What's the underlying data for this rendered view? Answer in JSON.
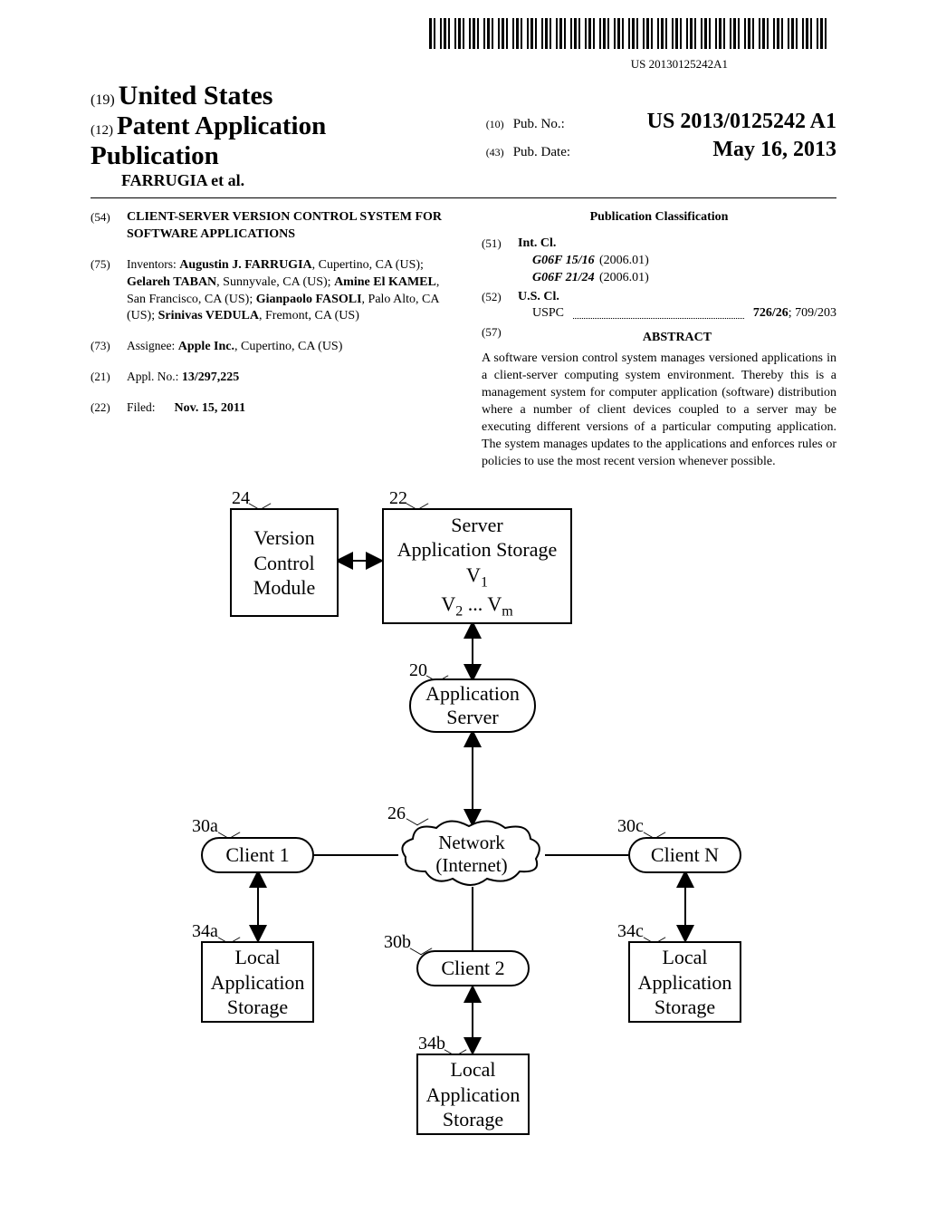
{
  "barcode_text": "US 20130125242A1",
  "header": {
    "code19": "(19)",
    "us": "United States",
    "code12": "(12)",
    "pubtype": "Patent Application Publication",
    "authors": "FARRUGIA et al.",
    "pubno_code": "(10)",
    "pubno_label": "Pub. No.:",
    "pubno": "US 2013/0125242 A1",
    "pubdate_code": "(43)",
    "pubdate_label": "Pub. Date:",
    "pubdate": "May 16, 2013"
  },
  "title_entry": {
    "num": "(54)",
    "text": "CLIENT-SERVER VERSION CONTROL SYSTEM FOR SOFTWARE APPLICATIONS"
  },
  "inventors_entry": {
    "num": "(75)",
    "label": "Inventors:",
    "text": "Augustin J. FARRUGIA, Cupertino, CA (US); Gelareh TABAN, Sunnyvale, CA (US); Amine El KAMEL, San Francisco, CA (US); Gianpaolo FASOLI, Palo Alto, CA (US); Srinivas VEDULA, Fremont, CA (US)"
  },
  "assignee_entry": {
    "num": "(73)",
    "label": "Assignee:",
    "text": "Apple Inc., Cupertino, CA (US)"
  },
  "appl_entry": {
    "num": "(21)",
    "label": "Appl. No.:",
    "text": "13/297,225"
  },
  "filed_entry": {
    "num": "(22)",
    "label": "Filed:",
    "text": "Nov. 15, 2011"
  },
  "classification": {
    "title": "Publication Classification",
    "intcl_num": "(51)",
    "intcl_label": "Int. Cl.",
    "intcl_rows": [
      {
        "code": "G06F 15/16",
        "year": "(2006.01)"
      },
      {
        "code": "G06F 21/24",
        "year": "(2006.01)"
      }
    ],
    "uscl_num": "(52)",
    "uscl_label": "U.S. Cl.",
    "uspc_label": "USPC",
    "uspc_codes": "726/26; 709/203"
  },
  "abstract": {
    "num": "(57)",
    "title": "ABSTRACT",
    "text": "A software version control system manages versioned applications in a client-server computing system environment. Thereby this is a management system for computer application (software) distribution where a number of client devices coupled to a server may be executing different versions of a particular computing application. The system manages updates to the applications and enforces rules or policies to use the most recent version whenever possible."
  },
  "figure": {
    "ref24": "24",
    "ref22": "22",
    "ref20": "20",
    "ref26": "26",
    "ref30a": "30a",
    "ref30b": "30b",
    "ref30c": "30c",
    "ref34a": "34a",
    "ref34b": "34b",
    "ref34c": "34c",
    "vcm1": "Version",
    "vcm2": "Control",
    "vcm3": "Module",
    "sas1": "Server",
    "sas2": "Application Storage",
    "v1": "V",
    "vsub1": "1",
    "v2": "V",
    "vsub2": "2",
    "vellip": " ... V",
    "vsubm": "m",
    "appserver1": "Application",
    "appserver2": "Server",
    "network1": "Network",
    "network2": "(Internet)",
    "client1": "Client 1",
    "client2": "Client 2",
    "clientn": "Client N",
    "las1": "Local",
    "las2": "Application",
    "las3": "Storage"
  }
}
